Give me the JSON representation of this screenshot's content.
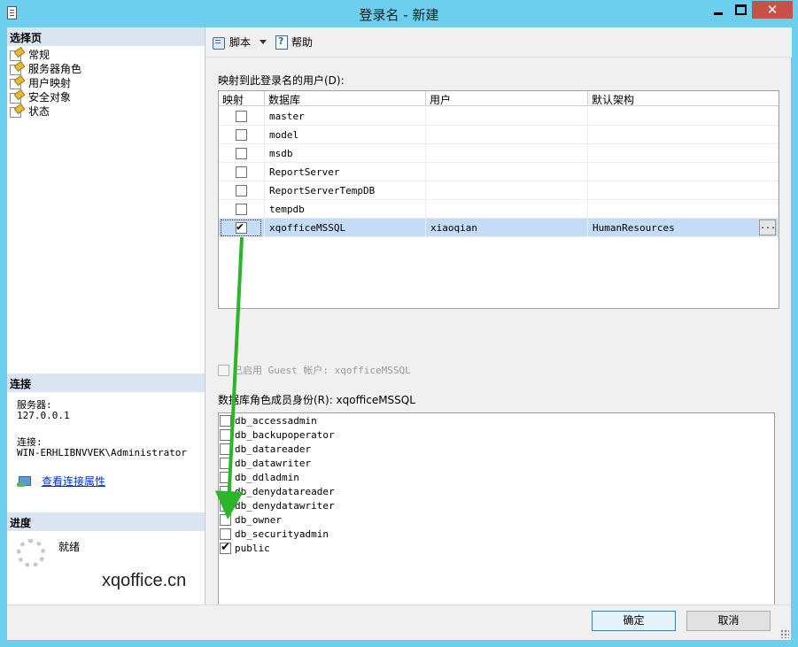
{
  "window": {
    "title": "登录名 - 新建",
    "close_glyph": "✕"
  },
  "left": {
    "select_page_header": "选择页",
    "pages": [
      {
        "label": "常规"
      },
      {
        "label": "服务器角色"
      },
      {
        "label": "用户映射"
      },
      {
        "label": "安全对象"
      },
      {
        "label": "状态"
      }
    ],
    "connection_header": "连接",
    "server_label": "服务器:",
    "server_value": "127.0.0.1",
    "connection_label": "连接:",
    "connection_value": "WIN-ERHLIBNVVEK\\Administrator",
    "view_connection_link": "查看连接属性",
    "progress_header": "进度",
    "progress_status": "就绪",
    "watermark": "xqoffice.cn"
  },
  "toolbar": {
    "script_label": "脚本",
    "help_label": "帮助"
  },
  "mapping": {
    "title": "映射到此登录名的用户(D):",
    "columns": [
      "映射",
      "数据库",
      "用户",
      "默认架构"
    ],
    "rows": [
      {
        "checked": false,
        "database": "master",
        "user": "",
        "schema": ""
      },
      {
        "checked": false,
        "database": "model",
        "user": "",
        "schema": ""
      },
      {
        "checked": false,
        "database": "msdb",
        "user": "",
        "schema": ""
      },
      {
        "checked": false,
        "database": "ReportServer",
        "user": "",
        "schema": ""
      },
      {
        "checked": false,
        "database": "ReportServerTempDB",
        "user": "",
        "schema": ""
      },
      {
        "checked": false,
        "database": "tempdb",
        "user": "",
        "schema": ""
      },
      {
        "checked": true,
        "database": "xqofficeMSSQL",
        "user": "xiaoqian",
        "schema": "HumanResources",
        "selected": true
      }
    ],
    "ellipsis_label": "..."
  },
  "guest": {
    "label": "已启用 Guest 帐户: xqofficeMSSQL"
  },
  "roles": {
    "title": "数据库角色成员身份(R): xqofficeMSSQL",
    "items": [
      {
        "label": "db_accessadmin",
        "checked": false
      },
      {
        "label": "db_backupoperator",
        "checked": false
      },
      {
        "label": "db_datareader",
        "checked": false
      },
      {
        "label": "db_datawriter",
        "checked": false
      },
      {
        "label": "db_ddladmin",
        "checked": false
      },
      {
        "label": "db_denydatareader",
        "checked": false
      },
      {
        "label": "db_denydatawriter",
        "checked": false
      },
      {
        "label": "db_owner",
        "checked": false
      },
      {
        "label": "db_securityadmin",
        "checked": false
      },
      {
        "label": "public",
        "checked": true
      }
    ]
  },
  "buttons": {
    "ok": "确定",
    "cancel": "取消"
  },
  "colors": {
    "title_bar": "#6ccfee",
    "selected_row": "#c4dcf5",
    "annotation_arrow": "#2bb52b",
    "section_header": "#dbe5f1"
  }
}
